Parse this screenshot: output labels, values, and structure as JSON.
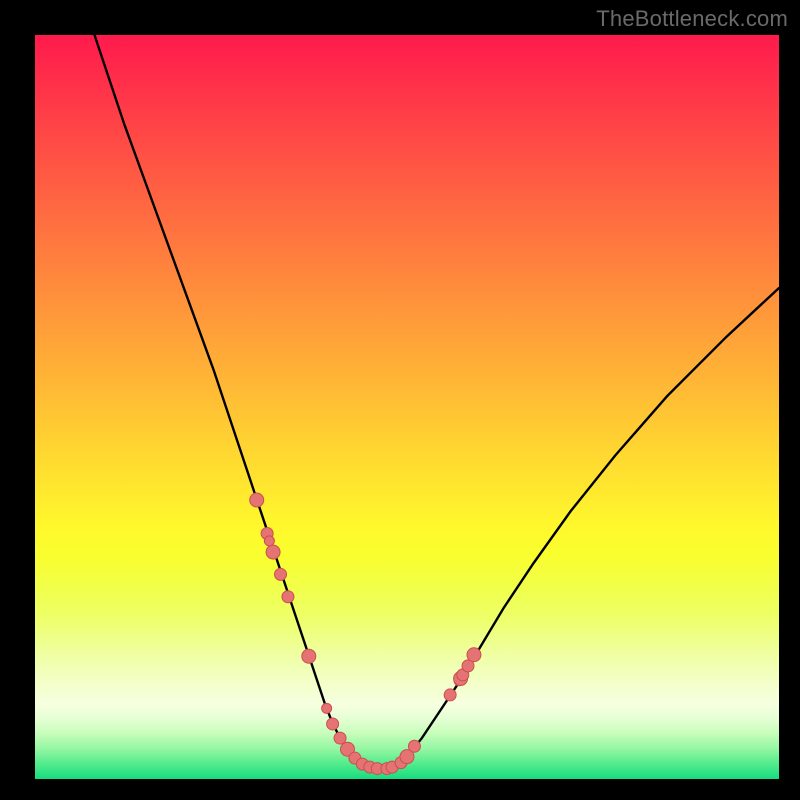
{
  "watermark": "TheBottleneck.com",
  "colors": {
    "background": "#000000",
    "curve": "#000000",
    "dot_fill": "#e57373",
    "dot_stroke": "#c94f4f",
    "gradient_top": "#ff1a4d",
    "gradient_bottom": "#16dd80"
  },
  "chart_data": {
    "type": "line",
    "title": "",
    "xlabel": "",
    "ylabel": "",
    "xlim": [
      0,
      100
    ],
    "ylim": [
      0,
      100
    ],
    "series": [
      {
        "name": "bottleneck-curve",
        "x": [
          8,
          12,
          16,
          20,
          24,
          27,
          29,
          31,
          33,
          35,
          36.5,
          38,
          39,
          40,
          41,
          42,
          43,
          44,
          45,
          46,
          47,
          48,
          49,
          50,
          52,
          54,
          57,
          60,
          63,
          67,
          72,
          78,
          85,
          93,
          100
        ],
        "y": [
          100,
          88,
          77,
          66,
          55,
          46,
          40,
          34,
          28,
          22,
          17.5,
          13,
          10,
          7.5,
          5.5,
          4,
          2.8,
          2,
          1.5,
          1.3,
          1.3,
          1.5,
          2,
          3,
          5.5,
          8.5,
          13,
          18,
          23,
          29,
          36,
          43.5,
          51.5,
          59.5,
          66
        ]
      }
    ],
    "scatter": [
      {
        "name": "data-points",
        "x": [
          29.8,
          31.2,
          31.5,
          32.0,
          33.0,
          34.0,
          36.8,
          39.2,
          40.0,
          41.0,
          42.0,
          43.0,
          44.0,
          45.0,
          46.0,
          47.3,
          48.0,
          49.2,
          50.0,
          51.0,
          55.8,
          57.0,
          57.2,
          57.5,
          58.2,
          59.0
        ],
        "y": [
          37.5,
          33.0,
          32.0,
          30.5,
          27.5,
          24.5,
          16.5,
          9.5,
          7.4,
          5.5,
          4.0,
          2.8,
          2.0,
          1.6,
          1.4,
          1.4,
          1.6,
          2.2,
          3.0,
          4.4,
          11.3,
          13.2,
          13.5,
          14.0,
          15.2,
          16.7
        ],
        "r": [
          7,
          6,
          5,
          7,
          6,
          6,
          7,
          5,
          6,
          6,
          7,
          6,
          6,
          6,
          6,
          6,
          6,
          6,
          7,
          6,
          6,
          5,
          7,
          6,
          6,
          7
        ]
      }
    ]
  }
}
